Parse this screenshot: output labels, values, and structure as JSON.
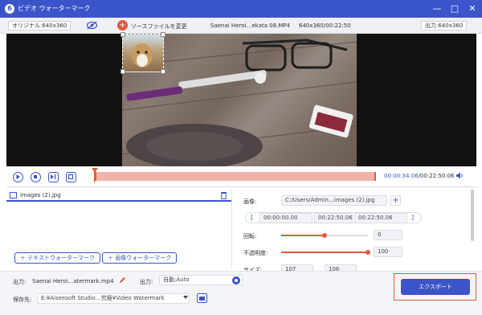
{
  "window": {
    "title": "ビデオ ウォーターマーク",
    "logo_glyph": "6",
    "minimize": "—",
    "maximize": "□",
    "close": "✕"
  },
  "infobar": {
    "original": "オリジナル:640x360",
    "change_source": "ソースファイルを変更",
    "file_info": "Saenai Heroi…ekata 08.MP4",
    "resolution_duration": "640x360/00:22:50",
    "output": "出力:640x360"
  },
  "player": {
    "current_time": "00:00:34.06",
    "total_time": "/00:22:50.06"
  },
  "watermark_list": {
    "items": [
      {
        "label": "images (2).jpg"
      }
    ],
    "add_text_label": "テキストウォーターマーク",
    "add_image_label": "画像ウォーターマーク"
  },
  "settings": {
    "image_label": "画像:",
    "image_path": "C:/Users/Admin…images (2).jpg",
    "start_time": "00:00:00.00",
    "mid_time": "00:22:50.06",
    "end_time": "00:22:50.06",
    "rotation_label": "回転:",
    "rotation_value": "0",
    "rotation_level": 0.5,
    "opacity_label": "不透明度:",
    "opacity_value": "100",
    "opacity_level": 1.0,
    "size_label": "サイズ:",
    "size_w": "107",
    "size_h": "106"
  },
  "bottom": {
    "output_label": "出力:",
    "output_file": "Saenai Heroi…atermark.mp4",
    "output_format_label": "出力:",
    "output_format": "自動;Auto",
    "save_label": "保存先:",
    "save_path": "E:¥Aiseesoft Studio…究極¥Video Watermark",
    "export_label": "エクスポート"
  },
  "colors": {
    "accent": "#3a54c9",
    "highlight": "#e05a3a"
  }
}
